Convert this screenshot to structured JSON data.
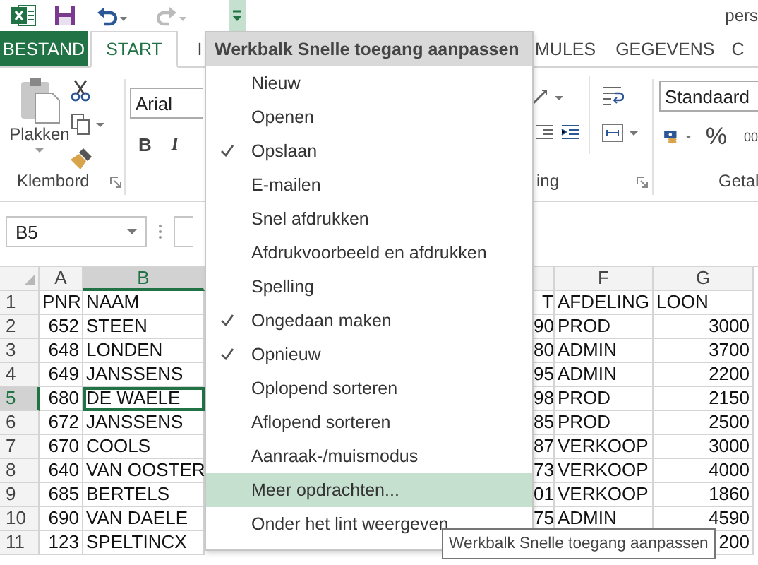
{
  "title_bar": {
    "title": "pers",
    "undo_enabled": true,
    "redo_enabled": false,
    "customize_button_active": true
  },
  "tabs": [
    {
      "label": "BESTAND",
      "kind": "file",
      "selected": false
    },
    {
      "label": "START",
      "kind": "tab",
      "selected": true
    },
    {
      "label": "I",
      "kind": "tab",
      "selected": false
    },
    {
      "label": "MULES",
      "kind": "tab",
      "selected": false
    },
    {
      "label": "GEGEVENS",
      "kind": "tab",
      "selected": false
    },
    {
      "label": "C",
      "kind": "tab",
      "selected": false
    }
  ],
  "ribbon": {
    "paste_label": "Plakken",
    "clipboard_group": "Klembord",
    "font_name": "Arial",
    "bold": "B",
    "italic": "I",
    "alignment_group": "ing",
    "number_format": "Standaard",
    "percent": "%",
    "thousands": "00",
    "number_group": "Getal"
  },
  "name_box": "B5",
  "sheet": {
    "column_headers": [
      {
        "label": "A",
        "selected": false
      },
      {
        "label": "B",
        "selected": true
      },
      {
        "label": "F",
        "selected": false
      },
      {
        "label": "G",
        "selected": false
      }
    ],
    "rows": [
      {
        "header": "1",
        "selected": false,
        "a": "PNR",
        "b": "NAAM",
        "e": "T",
        "f": "AFDELING",
        "g": "LOON"
      },
      {
        "header": "2",
        "selected": false,
        "a": "652",
        "b": "STEEN",
        "e": "90",
        "f": "PROD",
        "g": "3000"
      },
      {
        "header": "3",
        "selected": false,
        "a": "648",
        "b": "LONDEN",
        "e": "80",
        "f": "ADMIN",
        "g": "3700"
      },
      {
        "header": "4",
        "selected": false,
        "a": "649",
        "b": "JANSSENS",
        "e": "95",
        "f": "ADMIN",
        "g": "2200"
      },
      {
        "header": "5",
        "selected": true,
        "a": "680",
        "b": "DE WAELE",
        "e": "98",
        "f": "PROD",
        "g": "2150"
      },
      {
        "header": "6",
        "selected": false,
        "a": "672",
        "b": "JANSSENS",
        "e": "85",
        "f": "PROD",
        "g": "2500"
      },
      {
        "header": "7",
        "selected": false,
        "a": "670",
        "b": "COOLS",
        "e": "87",
        "f": "VERKOOP",
        "g": "3000"
      },
      {
        "header": "8",
        "selected": false,
        "a": "640",
        "b": "VAN OOSTER",
        "e": "73",
        "f": "VERKOOP",
        "g": "4000"
      },
      {
        "header": "9",
        "selected": false,
        "a": "685",
        "b": "BERTELS",
        "e": "01",
        "f": "VERKOOP",
        "g": "1860"
      },
      {
        "header": "10",
        "selected": false,
        "a": "690",
        "b": "VAN DAELE",
        "e": "75",
        "f": "ADMIN",
        "g": "4590"
      },
      {
        "header": "11",
        "selected": false,
        "a": "123",
        "b": "SPELTINCX",
        "g": "200"
      }
    ]
  },
  "menu": {
    "title": "Werkbalk Snelle toegang aanpassen",
    "items": [
      {
        "label": "Nieuw",
        "checked": false,
        "selected": false
      },
      {
        "label": "Openen",
        "checked": false,
        "selected": false
      },
      {
        "label": "Opslaan",
        "checked": true,
        "selected": false
      },
      {
        "label": "E-mailen",
        "checked": false,
        "selected": false
      },
      {
        "label": "Snel afdrukken",
        "checked": false,
        "selected": false
      },
      {
        "label": "Afdrukvoorbeeld en afdrukken",
        "checked": false,
        "selected": false
      },
      {
        "label": "Spelling",
        "checked": false,
        "selected": false
      },
      {
        "label": "Ongedaan maken",
        "checked": true,
        "selected": false
      },
      {
        "label": "Opnieuw",
        "checked": true,
        "selected": false
      },
      {
        "label": "Oplopend sorteren",
        "checked": false,
        "selected": false
      },
      {
        "label": "Aflopend sorteren",
        "checked": false,
        "selected": false
      },
      {
        "label": "Aanraak-/muismodus",
        "checked": false,
        "selected": false
      },
      {
        "label": "Meer opdrachten...",
        "checked": false,
        "selected": true
      },
      {
        "label": "Onder het lint weergeven",
        "checked": false,
        "selected": false
      }
    ]
  },
  "tooltip": "Werkbalk Snelle toegang aanpassen"
}
